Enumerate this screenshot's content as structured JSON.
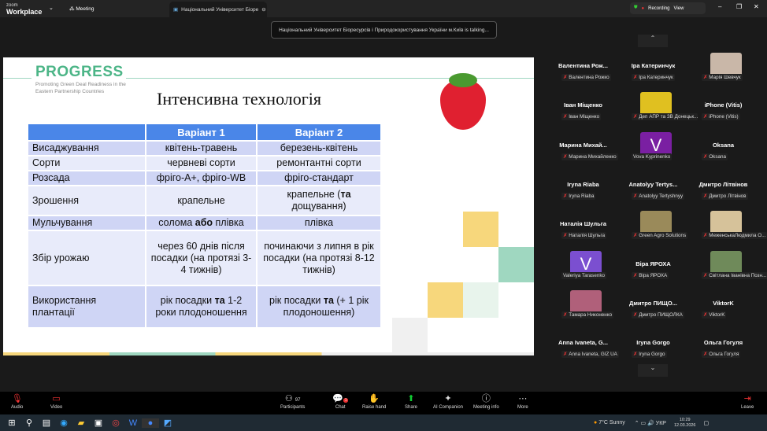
{
  "window": {
    "app_small": "zoom",
    "app_big": "Workplace",
    "meeting_tab": "Meeting",
    "tab_title": "Національний Університет Біоре",
    "recording": "Recording",
    "view": "View",
    "talking": "Національний Університет Біоресурсів і Природокористування України м.Київ is talking..."
  },
  "slide": {
    "logo": "PROGRESS",
    "logo_sub": "Promoting Green Deal Readiness in the Eastern Partnership Countries",
    "title": "Інтенсивна технологія",
    "headers": [
      "",
      "Варіант 1",
      "Варіант 2"
    ],
    "rows": [
      {
        "h": "Висаджування",
        "c1": {
          "a": "квітень-травень",
          "b": "",
          "c": ""
        },
        "c2": {
          "a": "березень-квітень",
          "b": "",
          "c": ""
        }
      },
      {
        "h": "Сорти",
        "c1": {
          "a": "червневі сорти",
          "b": "",
          "c": ""
        },
        "c2": {
          "a": "ремонтантні сорти",
          "b": "",
          "c": ""
        }
      },
      {
        "h": "Розсада",
        "c1": {
          "a": "фріго-А+, фріго-WB",
          "b": "",
          "c": ""
        },
        "c2": {
          "a": "фріго-стандарт",
          "b": "",
          "c": ""
        }
      },
      {
        "h": "Зрошення",
        "c1": {
          "a": "крапельне",
          "b": "",
          "c": ""
        },
        "c2": {
          "a": "крапельне (",
          "b": "та",
          "c": " дощування)"
        }
      },
      {
        "h": "Мульчування",
        "c1": {
          "a": "солома ",
          "b": "або",
          "c": " плівка"
        },
        "c2": {
          "a": "плівка",
          "b": "",
          "c": ""
        }
      },
      {
        "h": "Збір урожаю",
        "c1": {
          "a": "через 60 днів після посадки (на протязі 3-4 тижнів)",
          "b": "",
          "c": ""
        },
        "c2": {
          "a": "починаючи з липня в рік посадки (на протязі 8-12 тижнів)",
          "b": "",
          "c": ""
        }
      },
      {
        "h": "Використання плантації",
        "c1": {
          "a": "рік посадки ",
          "b": "та",
          "c": " 1-2 роки плодоношення"
        },
        "c2": {
          "a": "рік посадки ",
          "b": "та",
          "c": " (+ 1 рік плодоношення)"
        }
      }
    ]
  },
  "participants": [
    {
      "name": "Валентина Рож...",
      "label": "Валентина Рожко",
      "type": "name"
    },
    {
      "name": "Іра Катеринчук",
      "label": "Іра Катеринчук",
      "type": "name"
    },
    {
      "name": "",
      "label": "Марія Шевчук",
      "type": "photo",
      "color": "#c9b7a8"
    },
    {
      "name": "Іван Міщенко",
      "label": "Іван Міщенко",
      "type": "name"
    },
    {
      "name": "",
      "label": "Деп АПР та ЗВ Донецьк...",
      "type": "photo",
      "color": "#e0c020"
    },
    {
      "name": "iPhone (Vitis)",
      "label": "iPhone (Vitis)",
      "type": "name"
    },
    {
      "name": "Марина Михай...",
      "label": "Марина Михайленко",
      "type": "name"
    },
    {
      "name": "V",
      "label": "Vova Kyprinenko",
      "type": "letter",
      "color": "#7a1fa2"
    },
    {
      "name": "Oksana",
      "label": "Oksana",
      "type": "name"
    },
    {
      "name": "Iryna Riaba",
      "label": "Iryna Riaba",
      "type": "name"
    },
    {
      "name": "Anatolyy Tertys...",
      "label": "Anatolyy Tertyshnyy",
      "type": "name"
    },
    {
      "name": "Дмитро Літвінов",
      "label": "Дмитро Літвінов",
      "type": "name"
    },
    {
      "name": "Наталія Шульга",
      "label": "Наталія Шульга",
      "type": "name"
    },
    {
      "name": "",
      "label": "Green Agro Solutions",
      "type": "photo",
      "color": "#9a8a5a"
    },
    {
      "name": "",
      "label": "МеженськаЛюдмила О...",
      "type": "photo",
      "color": "#d6c29a"
    },
    {
      "name": "V",
      "label": "Valeriya Tarasenko",
      "type": "letter",
      "color": "#7b4fd0"
    },
    {
      "name": "Віра ЯРОХА",
      "label": "Віра ЯРОХА",
      "type": "name"
    },
    {
      "name": "",
      "label": "Світлана Іванівна Позн...",
      "type": "photo",
      "color": "#6f8a5a"
    },
    {
      "name": "",
      "label": "Тамара Никоненко",
      "type": "photo",
      "color": "#b0607a"
    },
    {
      "name": "Дмитро ПИЩО...",
      "label": "Дмитро ПИЩОЛКА",
      "type": "name"
    },
    {
      "name": "ViktorK",
      "label": "ViktorK",
      "type": "name"
    },
    {
      "name": "Anna Ivaneta, G...",
      "label": "Anna Ivaneta, GIZ UA",
      "type": "name"
    },
    {
      "name": "Iryna Gorgo",
      "label": "Iryna Gorgo",
      "type": "name"
    },
    {
      "name": "Ольга Гогуля",
      "label": "Ольга Гогуля",
      "type": "name"
    }
  ],
  "toolbar": {
    "audio": "Audio",
    "video": "Video",
    "participants": "Participants",
    "participants_count": "97",
    "chat": "Chat",
    "chat_badge": "1",
    "raise": "Raise hand",
    "share": "Share",
    "ai": "AI Companion",
    "info": "Meeting info",
    "more": "More",
    "leave": "Leave"
  },
  "taskbar": {
    "weather": "7°C  Sunny",
    "lang": "УКР",
    "time": "10:29",
    "date": "12.03.2026"
  }
}
